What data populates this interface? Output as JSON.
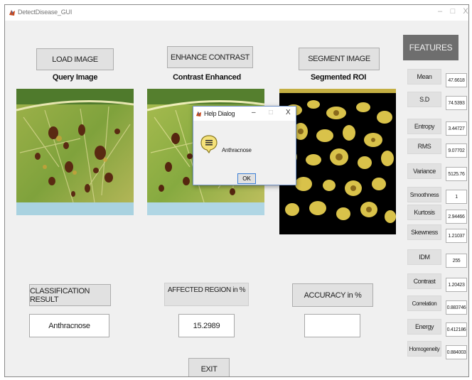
{
  "window": {
    "title": "DetectDisease_GUI"
  },
  "buttons": {
    "load_image": "LOAD IMAGE",
    "enhance_contrast": "ENHANCE CONTRAST",
    "segment_image": "SEGMENT IMAGE",
    "classification_result": "CLASSIFICATION RESULT",
    "accuracy": "ACCURACY in %",
    "exit": "EXIT"
  },
  "captions": {
    "query": "Query Image",
    "enhanced": "Contrast Enhanced",
    "segmented": "Segmented ROI"
  },
  "results": {
    "affected_label": "AFFECTED REGION in %",
    "classification_value": "Anthracnose",
    "affected_value": "15.2989",
    "accuracy_value": ""
  },
  "features": {
    "header": "FEATURES",
    "items": [
      {
        "label": "Mean",
        "value": "47.6618"
      },
      {
        "label": "S.D",
        "value": "74.5393"
      },
      {
        "label": "Entropy",
        "value": "3.44727"
      },
      {
        "label": "RMS",
        "value": "9.07702"
      },
      {
        "label": "Variance",
        "value": "5125.76"
      },
      {
        "label": "Smoothness",
        "value": "1"
      },
      {
        "label": "Kurtosis",
        "value": "2.94466"
      },
      {
        "label": "Skewness",
        "value": "1.21037"
      },
      {
        "label": "IDM",
        "value": "255"
      },
      {
        "label": "Contrast",
        "value": "1.20423"
      },
      {
        "label": "Correlation",
        "value": "0.883746"
      },
      {
        "label": "Energy",
        "value": "0.412186"
      },
      {
        "label": "Homogeneity",
        "value": "0.884003"
      }
    ]
  },
  "dialog": {
    "title": "Help Dialog",
    "message": "Anthracnose",
    "ok_label": "OK",
    "icon": "help-info-icon"
  },
  "colors": {
    "window_bg": "#f0f0f0",
    "button_bg": "#e1e1e1",
    "features_header_bg": "#6e6e6e",
    "leaf_green": "#7fa23c",
    "lesion_brown": "#5a2a12",
    "roi_bg": "#000000",
    "roi_spot": "#d9c24a"
  }
}
